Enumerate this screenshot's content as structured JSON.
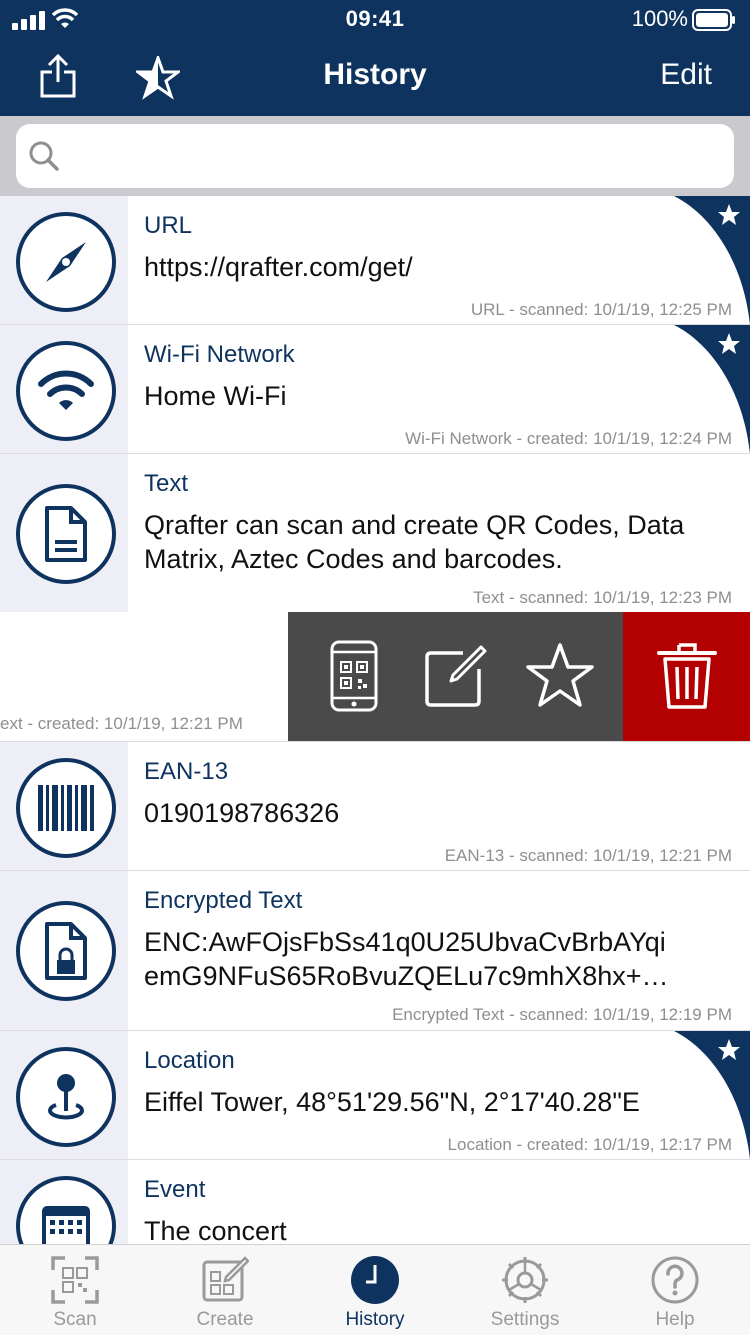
{
  "status": {
    "time": "09:41",
    "battery": "100%"
  },
  "nav": {
    "title": "History",
    "edit_label": "Edit"
  },
  "search": {
    "placeholder": ""
  },
  "items": [
    {
      "type": "URL",
      "content": "https://qrafter.com/get/",
      "meta": "URL - scanned: 10/1/19, 12:25 PM",
      "favorite": true,
      "icon": "compass-icon"
    },
    {
      "type": "Wi-Fi Network",
      "content": "Home Wi-Fi",
      "meta": "Wi-Fi Network - created: 10/1/19, 12:24 PM",
      "favorite": true,
      "icon": "wifi-icon"
    },
    {
      "type": "Text",
      "content": "Qrafter can scan and create QR Codes, Data Matrix, Aztec Codes and barcodes.",
      "meta": "Text - scanned: 10/1/19, 12:23 PM",
      "favorite": false,
      "icon": "document-icon"
    },
    {
      "type": "",
      "content": "",
      "meta": "ext - created: 10/1/19, 12:21 PM",
      "favorite": false,
      "icon": ""
    },
    {
      "type": "EAN-13",
      "content": "0190198786326",
      "meta": "EAN-13 - scanned: 10/1/19, 12:21 PM",
      "favorite": false,
      "icon": "barcode-icon"
    },
    {
      "type": "Encrypted Text",
      "content": "ENC:AwFOjsFbSs41q0U25UbvaCvBrbAYqi emG9NFuS65RoBvuZQELu7c9mhX8hx+…",
      "content_line1": "ENC:AwFOjsFbSs41q0U25UbvaCvBrbAYqi",
      "content_line2": "emG9NFuS65RoBvuZQELu7c9mhX8hx+…",
      "meta": "Encrypted Text - scanned: 10/1/19, 12:19 PM",
      "favorite": false,
      "icon": "locked-document-icon"
    },
    {
      "type": "Location",
      "content": "Eiffel Tower, 48°51'29.56\"N, 2°17'40.28\"E",
      "meta": "Location - created: 10/1/19, 12:17 PM",
      "favorite": true,
      "icon": "location-pin-icon"
    },
    {
      "type": "Event",
      "content": "The concert",
      "meta": "",
      "favorite": false,
      "icon": "calendar-icon"
    }
  ],
  "swipe_actions": [
    "show-code",
    "edit",
    "favorite",
    "delete"
  ],
  "tabs": [
    {
      "label": "Scan",
      "icon": "scan-icon",
      "active": false
    },
    {
      "label": "Create",
      "icon": "create-icon",
      "active": false
    },
    {
      "label": "History",
      "icon": "history-icon",
      "active": true
    },
    {
      "label": "Settings",
      "icon": "settings-icon",
      "active": false
    },
    {
      "label": "Help",
      "icon": "help-icon",
      "active": false
    }
  ],
  "colors": {
    "navy": "#0e335f",
    "delete_red": "#b30000",
    "action_gray": "#4a4a4a"
  }
}
